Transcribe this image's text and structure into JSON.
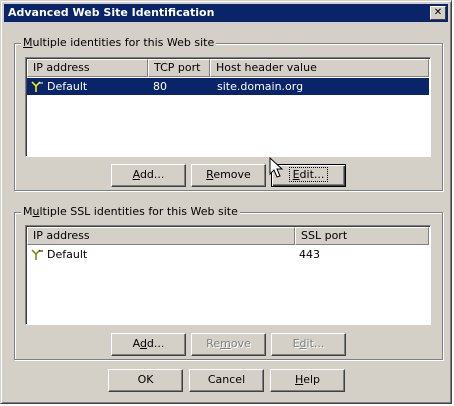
{
  "window": {
    "title": "Advanced Web Site Identification",
    "close_glyph": "✕"
  },
  "identities": {
    "legend_pre": "",
    "legend_ul": "M",
    "legend_post": "ultiple identities for this Web site",
    "columns": [
      "IP address",
      "TCP port",
      "Host header value"
    ],
    "rows": [
      {
        "ip": "Default",
        "port": "80",
        "host": "site.domain.org",
        "selected": true
      }
    ],
    "buttons": {
      "add": {
        "pre": "",
        "ul": "A",
        "post": "dd..."
      },
      "remove": {
        "pre": "",
        "ul": "R",
        "post": "emove"
      },
      "edit": {
        "pre": "",
        "ul": "E",
        "post": "dit..."
      }
    }
  },
  "ssl": {
    "legend_pre": "M",
    "legend_ul": "u",
    "legend_post": "ltiple SSL identities for this Web site",
    "columns": [
      "IP address",
      "SSL port"
    ],
    "rows": [
      {
        "ip": "Default",
        "port": "443",
        "selected": false
      }
    ],
    "buttons": {
      "add": {
        "pre": "A",
        "ul": "d",
        "post": "d..."
      },
      "remove": {
        "pre": "Re",
        "ul": "m",
        "post": "ove"
      },
      "edit": {
        "pre": "E",
        "ul": "d",
        "post": "it..."
      }
    }
  },
  "footer": {
    "ok": "OK",
    "cancel": "Cancel",
    "help": {
      "pre": "",
      "ul": "H",
      "post": "elp"
    }
  },
  "colors": {
    "titlebar": "#0a246a",
    "face": "#d4d0c8",
    "selection": "#0a246a"
  },
  "icons": [
    "site-identity-icon",
    "close-icon",
    "mouse-pointer-icon"
  ]
}
